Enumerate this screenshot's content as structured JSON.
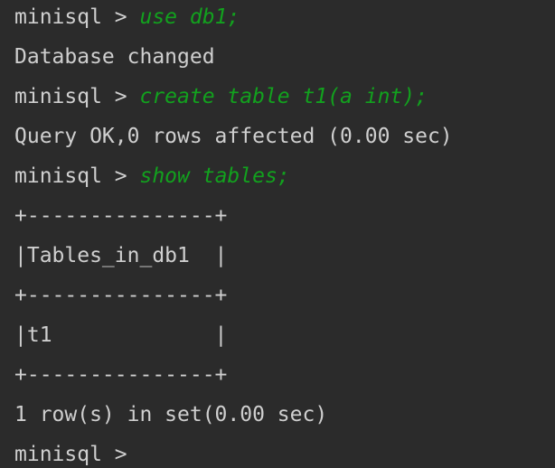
{
  "terminal": {
    "prompt": "minisql > ",
    "lines": [
      {
        "command": "use db1;"
      },
      {
        "output": "Database changed"
      },
      {
        "command": "create table t1(a int);"
      },
      {
        "output": "Query OK,0 rows affected (0.00 sec)"
      },
      {
        "command": "show tables;"
      },
      {
        "output": "+---------------+"
      },
      {
        "output": "|Tables_in_db1  |"
      },
      {
        "output": "+---------------+"
      },
      {
        "output": "|t1             |"
      },
      {
        "output": "+---------------+"
      },
      {
        "output": "1 row(s) in set(0.00 sec)"
      },
      {
        "command": ""
      }
    ]
  },
  "colors": {
    "background": "#2b2b2b",
    "text": "#cfcfcf",
    "command": "#12a11e"
  }
}
